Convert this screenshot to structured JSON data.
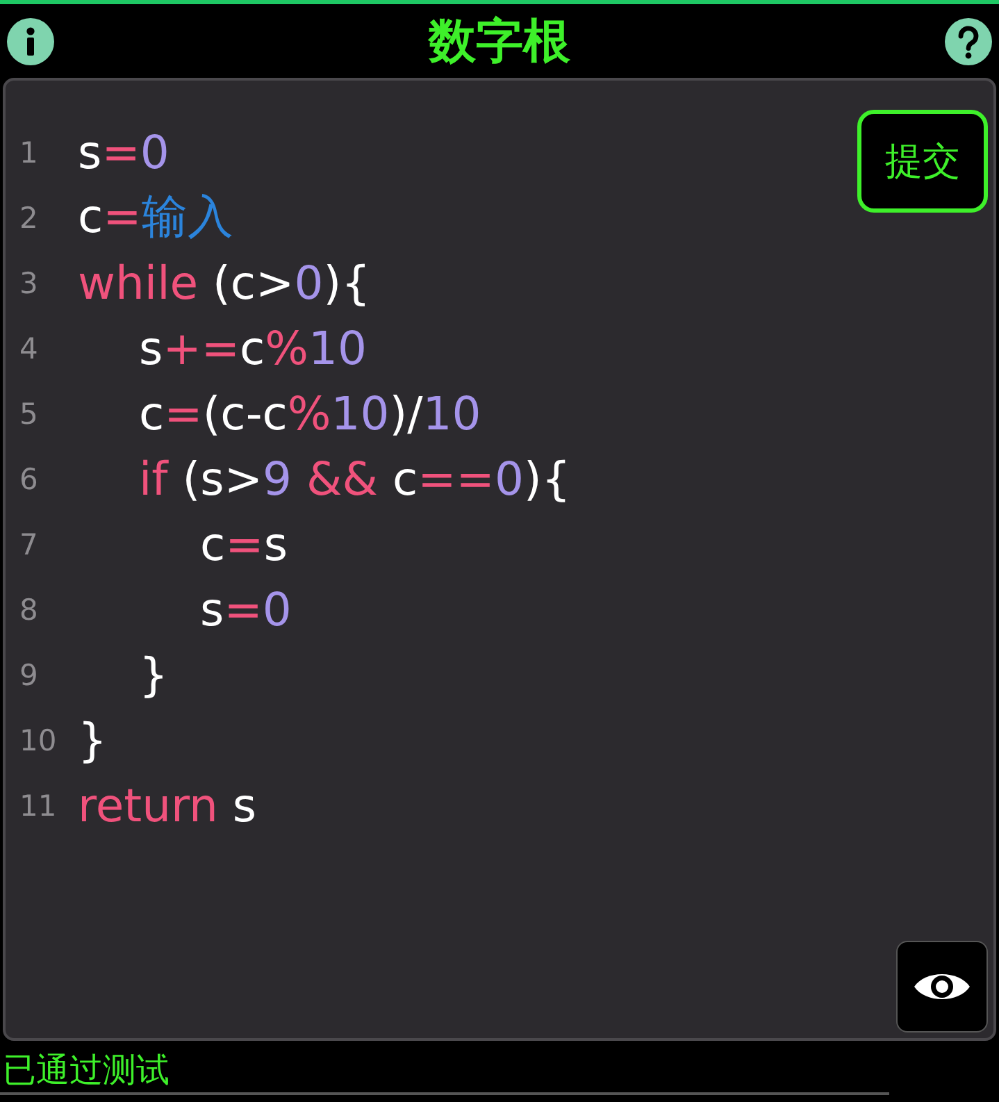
{
  "header": {
    "title": "数字根"
  },
  "submit_button": {
    "label": "提交"
  },
  "code": [
    {
      "number": "1",
      "tokens": [
        {
          "text": "s",
          "kind": "plain"
        },
        {
          "text": "=",
          "kind": "op"
        },
        {
          "text": "0",
          "kind": "num"
        }
      ]
    },
    {
      "number": "2",
      "tokens": [
        {
          "text": "c",
          "kind": "plain"
        },
        {
          "text": "=",
          "kind": "op"
        },
        {
          "text": "输入",
          "kind": "input"
        }
      ]
    },
    {
      "number": "3",
      "tokens": [
        {
          "text": "while",
          "kind": "keyword"
        },
        {
          "text": " (c>",
          "kind": "plain"
        },
        {
          "text": "0",
          "kind": "num"
        },
        {
          "text": "){",
          "kind": "plain"
        }
      ],
      "children": [
        {
          "number": "4",
          "tokens": [
            {
              "text": "s",
              "kind": "plain"
            },
            {
              "text": "+=",
              "kind": "op"
            },
            {
              "text": "c",
              "kind": "plain"
            },
            {
              "text": "%",
              "kind": "op"
            },
            {
              "text": "10",
              "kind": "num"
            }
          ]
        },
        {
          "number": "5",
          "tokens": [
            {
              "text": "c",
              "kind": "plain"
            },
            {
              "text": "=",
              "kind": "op"
            },
            {
              "text": "(c-c",
              "kind": "plain"
            },
            {
              "text": "%",
              "kind": "op"
            },
            {
              "text": "10",
              "kind": "num"
            },
            {
              "text": ")/",
              "kind": "plain"
            },
            {
              "text": "10",
              "kind": "num"
            }
          ]
        },
        {
          "number": "6",
          "tokens": [
            {
              "text": "if",
              "kind": "keyword"
            },
            {
              "text": " (s>",
              "kind": "plain"
            },
            {
              "text": "9",
              "kind": "num"
            },
            {
              "text": " &&",
              "kind": "op"
            },
            {
              "text": " c",
              "kind": "plain"
            },
            {
              "text": "==",
              "kind": "op"
            },
            {
              "text": "0",
              "kind": "num"
            },
            {
              "text": "){",
              "kind": "plain"
            }
          ],
          "children": [
            {
              "number": "7",
              "tokens": [
                {
                  "text": "c",
                  "kind": "plain"
                },
                {
                  "text": "=",
                  "kind": "op"
                },
                {
                  "text": "s",
                  "kind": "plain"
                }
              ]
            },
            {
              "number": "8",
              "tokens": [
                {
                  "text": "s",
                  "kind": "plain"
                },
                {
                  "text": "=",
                  "kind": "op"
                },
                {
                  "text": "0",
                  "kind": "num"
                }
              ]
            }
          ]
        },
        {
          "number": "9",
          "tokens": [
            {
              "text": "}",
              "kind": "plain"
            }
          ]
        }
      ]
    },
    {
      "number": "10",
      "tokens": [
        {
          "text": "}",
          "kind": "plain"
        }
      ]
    },
    {
      "number": "11",
      "tokens": [
        {
          "text": "return",
          "kind": "keyword"
        },
        {
          "text": " s",
          "kind": "plain"
        }
      ]
    }
  ],
  "status": "已通过测试"
}
